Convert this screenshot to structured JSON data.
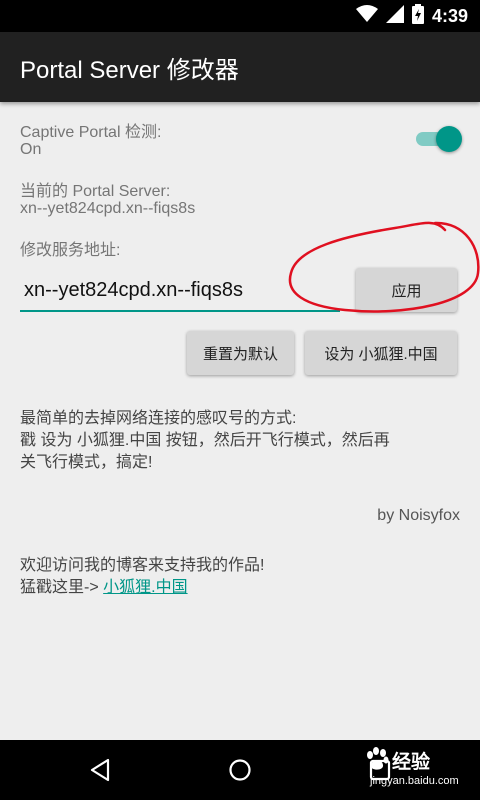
{
  "status_bar": {
    "time": "4:39"
  },
  "app_bar": {
    "title": "Portal Server 修改器"
  },
  "captive": {
    "label": "Captive Portal 检测:",
    "state": "On",
    "enabled": true
  },
  "current_server": {
    "label": "当前的 Portal Server:",
    "value": "xn--yet824cpd.xn--fiqs8s"
  },
  "modify": {
    "label": "修改服务地址:",
    "input_value": "xn--yet824cpd.xn--fiqs8s",
    "apply_label": "应用"
  },
  "actions": {
    "reset_label": "重置为默认",
    "set_fox_label": "设为 小狐狸.中国"
  },
  "instructions": {
    "line1": "最简单的去掉网络连接的感叹号的方式:",
    "line2": "戳 设为 小狐狸.中国 按钮，然后开飞行模式，然后再",
    "line3": "关飞行模式，搞定!"
  },
  "byline": "by Noisyfox",
  "promo": {
    "line1": "欢迎访问我的博客来支持我的作品!",
    "line2_prefix": "猛戳这里->",
    "link_text": "小狐狸.中国"
  },
  "watermark": {
    "text": "经验",
    "url": "jingyan.baidu.com"
  },
  "colors": {
    "accent": "#009688",
    "app_bar": "#212121",
    "annotation": "#e01020"
  },
  "icons": [
    "wifi-icon",
    "signal-icon",
    "battery-icon",
    "back-icon",
    "home-icon",
    "recents-icon",
    "paw-icon"
  ]
}
